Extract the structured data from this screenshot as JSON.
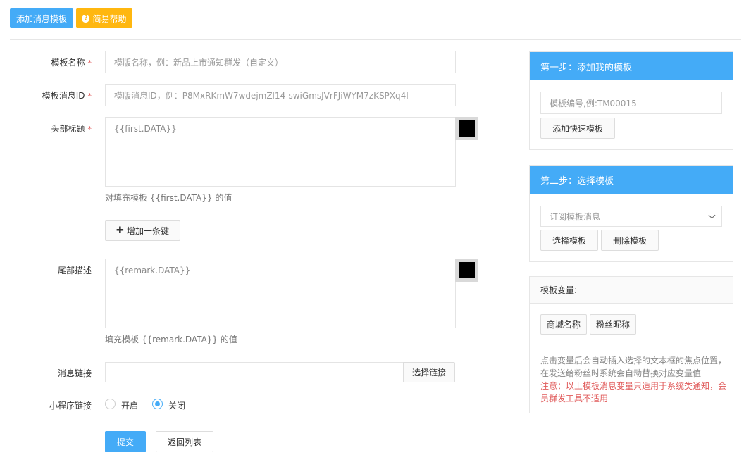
{
  "toolbar": {
    "add_template_label": "添加消息模板",
    "help_label": "简易帮助",
    "help_icon": "question-circle-icon"
  },
  "form": {
    "name_label": "模板名称",
    "name_placeholder": "模版名称，例：新品上市通知群发（自定义）",
    "id_label": "模板消息ID",
    "id_placeholder": "模版消息ID，例：P8MxRKmW7wdejmZl14-swiGmsJVrFJiWYM7zKSPXq4I",
    "header_label": "头部标题",
    "header_value": "{{first.DATA}}",
    "header_hint": "对填充模板 {{first.DATA}} 的值",
    "header_color": "#000000",
    "add_key_label": "增加一条键",
    "add_key_icon": "plus-icon",
    "footer_label": "尾部描述",
    "footer_value": "{{remark.DATA}}",
    "footer_hint": "填充模板 {{remark.DATA}} 的值",
    "footer_color": "#000000",
    "link_label": "消息链接",
    "link_value": "",
    "link_button": "选择链接",
    "mini_label": "小程序链接",
    "mini_on": "开启",
    "mini_off": "关闭",
    "mini_selected": "关闭",
    "required_mark": "*",
    "submit_label": "提交",
    "back_label": "返回列表"
  },
  "step1": {
    "title": "第一步：添加我的模板",
    "input_placeholder": "模板编号,例:TM00015",
    "button": "添加快速模板"
  },
  "step2": {
    "title": "第二步：选择模板",
    "select_value": "订阅模板消息",
    "select_button": "选择模板",
    "delete_button": "删除模板"
  },
  "vars": {
    "title": "模板变量:",
    "tags": [
      "商城名称",
      "粉丝昵称"
    ],
    "note": "点击变量后会自动插入选择的文本框的焦点位置，在发送给粉丝时系统会自动替换对应变量值",
    "warning": "注意：以上模板消息变量只适用于系统类通知，会员群发工具不适用"
  },
  "colors": {
    "primary": "#44abf7",
    "warning": "#ffb70f",
    "danger": "#e05a5a"
  }
}
